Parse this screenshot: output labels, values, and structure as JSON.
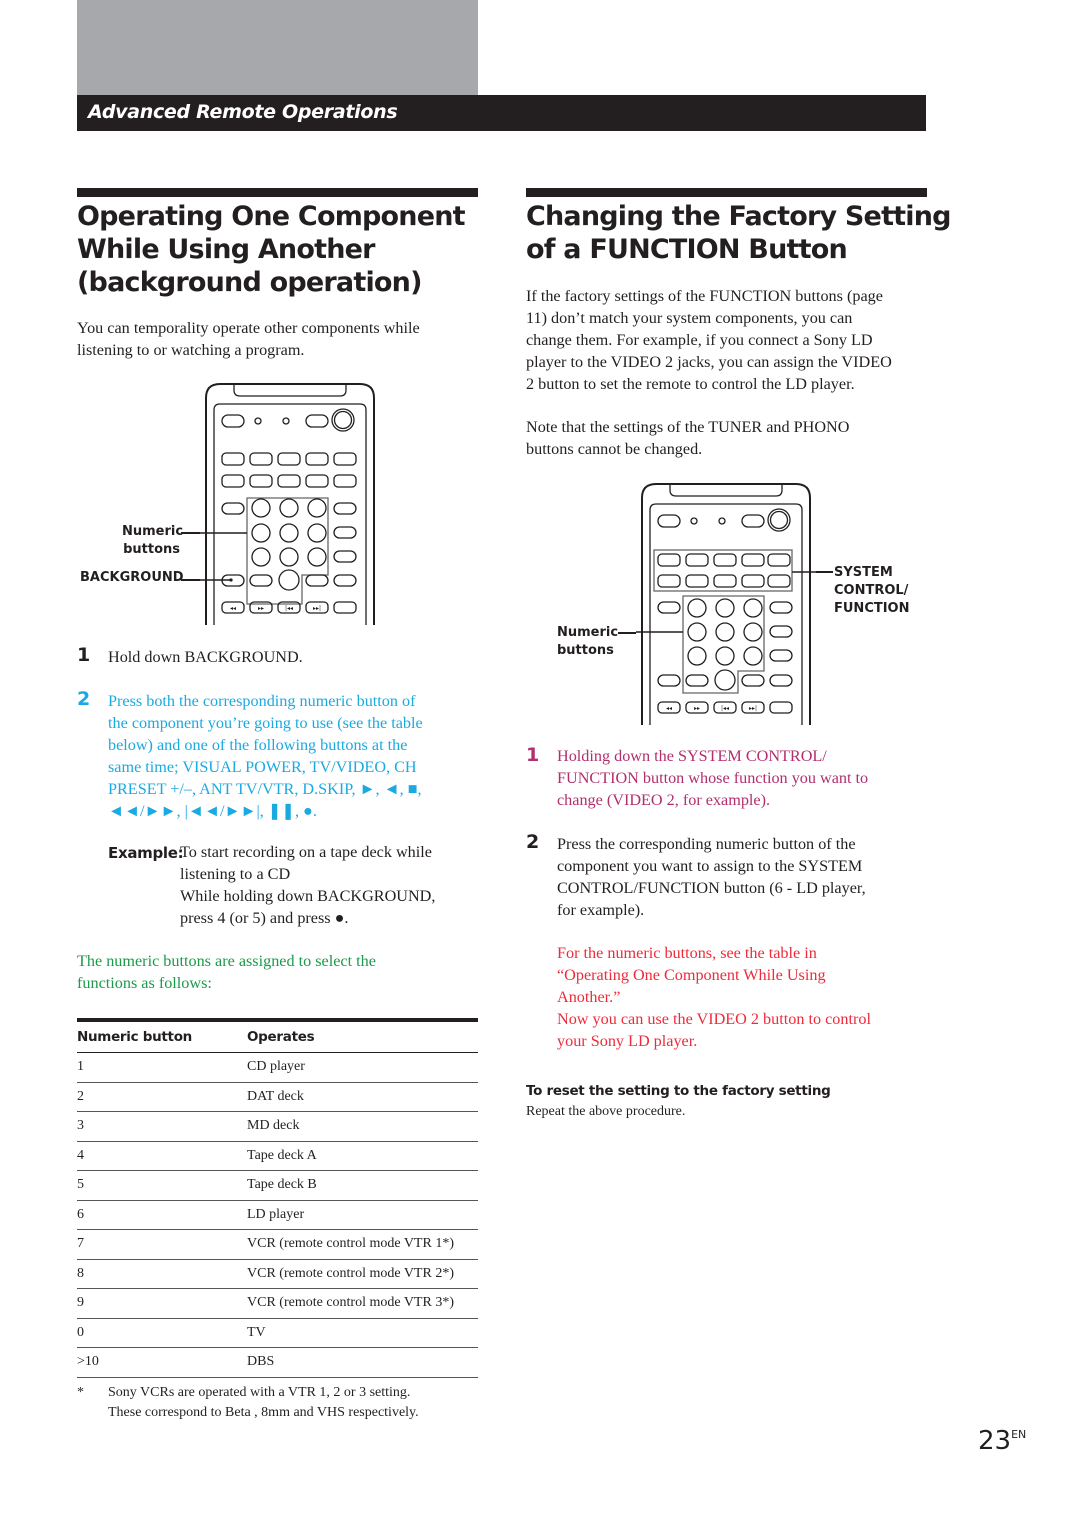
{
  "header": {
    "section_title": "Advanced Remote Operations"
  },
  "left": {
    "title_lines": [
      "Operating One Component",
      "While Using Another",
      "(background operation)"
    ],
    "intro_lines": [
      "You can temporality operate other components while",
      "listening to or watching a program."
    ],
    "figure": {
      "callout_numeric": [
        "Numeric",
        "buttons"
      ],
      "callout_background": "BACKGROUND"
    },
    "steps": [
      {
        "number": "1",
        "lines": [
          "Hold down BACKGROUND."
        ]
      },
      {
        "number": "2",
        "lines": [
          "Press both the corresponding numeric button of",
          "the component you’re going to use (see the table",
          "below) and one of the following buttons at the",
          "same time; VISUAL POWER, TV/VIDEO, CH",
          "PRESET +/–, ANT TV/VTR, D.SKIP, ►, ◄, ■,",
          "◄◄/►►, |◄◄/►►|, ❚❚, ●."
        ]
      }
    ],
    "example": {
      "label": "Example:",
      "lines": [
        "To start recording on a tape deck while",
        "listening to a CD",
        "While holding down BACKGROUND,",
        "press 4 (or 5)  and press ●."
      ]
    },
    "table_intro_lines": [
      "The numeric buttons are assigned to select the",
      "functions as follows:"
    ],
    "table": {
      "headers": [
        "Numeric button",
        "Operates"
      ],
      "rows": [
        [
          "1",
          "CD player"
        ],
        [
          "2",
          "DAT deck"
        ],
        [
          "3",
          "MD deck"
        ],
        [
          "4",
          "Tape deck A"
        ],
        [
          "5",
          "Tape deck B"
        ],
        [
          "6",
          "LD player"
        ],
        [
          "7",
          "VCR (remote control mode VTR 1*)"
        ],
        [
          "8",
          "VCR (remote control mode VTR 2*)"
        ],
        [
          "9",
          "VCR (remote control mode VTR 3*)"
        ],
        [
          "0",
          "TV"
        ],
        [
          ">10",
          "DBS"
        ]
      ]
    },
    "footnote": {
      "marker": "*",
      "lines": [
        "Sony VCRs are operated with a VTR 1, 2 or 3 setting.",
        "These correspond to Beta , 8mm and VHS respectively."
      ]
    }
  },
  "right": {
    "title_lines": [
      "Changing the Factory Setting",
      "of a FUNCTION Button"
    ],
    "para1_lines": [
      "If the factory settings of the FUNCTION buttons (page",
      "11) don’t match your system components, you can",
      "change them. For example, if you connect a Sony LD",
      "player to the VIDEO 2 jacks, you can assign the VIDEO",
      "2 button to set the remote to control the LD player."
    ],
    "para2_lines": [
      "Note that the settings of the TUNER and PHONO",
      "buttons cannot be changed."
    ],
    "figure": {
      "callout_system": [
        "SYSTEM",
        "CONTROL/",
        "FUNCTION"
      ],
      "callout_numeric": [
        "Numeric",
        "buttons"
      ]
    },
    "steps": [
      {
        "number": "1",
        "lines": [
          "Holding down the SYSTEM CONTROL/",
          "FUNCTION button whose function you want to",
          "change (VIDEO 2, for example)."
        ]
      },
      {
        "number": "2",
        "lines": [
          "Press the corresponding numeric button of the",
          "component you want to assign to the SYSTEM",
          "CONTROL/FUNCTION button (6 - LD player,",
          "for example)."
        ]
      }
    ],
    "note_lines": [
      "For the numeric buttons, see the table in",
      "“Operating One Component While Using",
      "Another.”",
      "Now you can use the VIDEO 2 button to control",
      "your Sony LD player."
    ],
    "reset_heading": "To reset the setting to the factory setting",
    "reset_text": "Repeat the above procedure."
  },
  "page": {
    "number": "23",
    "suffix": "EN"
  },
  "colors": {
    "cyan": "#1ba9e1",
    "magenta": "#b22e6e",
    "red": "#ee2b3a",
    "green": "#1a9a4a",
    "header_bg": "#231f20",
    "grey_block": "#a7a8ab"
  }
}
